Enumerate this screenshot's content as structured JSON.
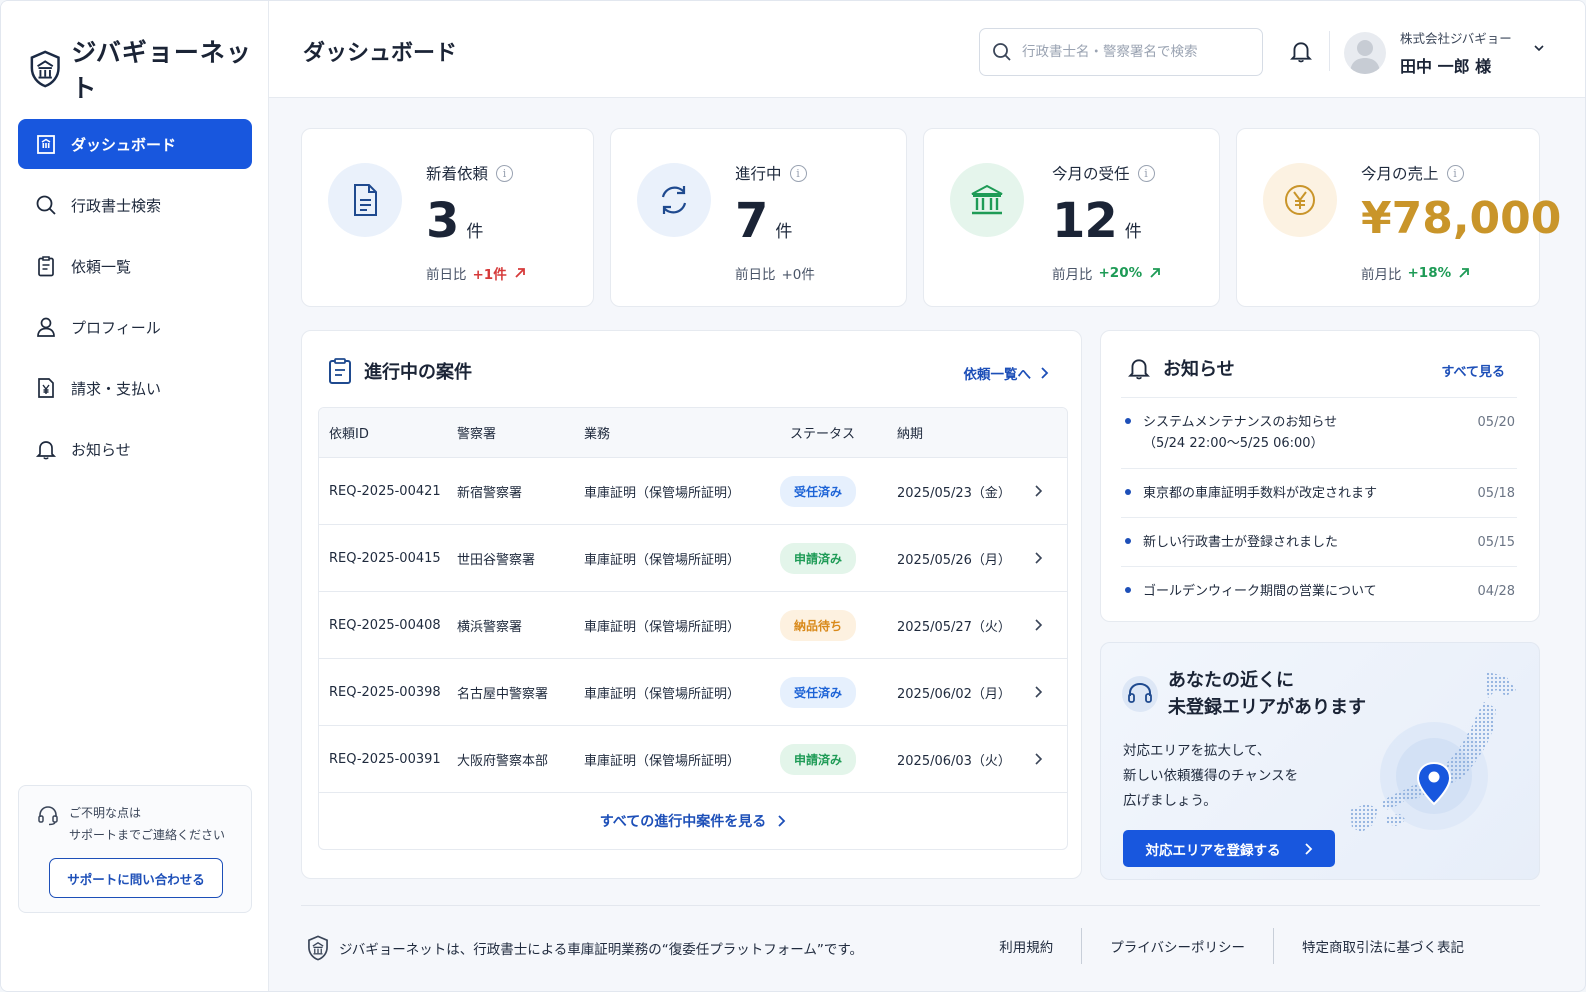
{
  "app": {
    "name": "ジバギョーネット"
  },
  "sidebar": {
    "items": [
      {
        "label": "ダッシュボード",
        "icon": "building-icon",
        "active": true
      },
      {
        "label": "行政書士検索",
        "icon": "search-icon"
      },
      {
        "label": "依頼一覧",
        "icon": "clipboard-icon"
      },
      {
        "label": "プロフィール",
        "icon": "user-icon"
      },
      {
        "label": "請求・支払い",
        "icon": "invoice-yen-icon"
      },
      {
        "label": "お知らせ",
        "icon": "bell-icon"
      }
    ],
    "support": {
      "line1": "ご不明な点は",
      "line2": "サポートまでご連絡ください",
      "button": "サポートに問い合わせる"
    }
  },
  "header": {
    "title": "ダッシュボード",
    "search_placeholder": "行政書士名・警察署名で検索",
    "user": {
      "company": "株式会社ジバギョー",
      "name": "田中 一郎 様"
    }
  },
  "stats": [
    {
      "label": "新着依頼",
      "value": "3",
      "unit": "件",
      "compare_label": "前日比",
      "delta": "+1件",
      "trend": "up",
      "color": "#d63a3a"
    },
    {
      "label": "進行中",
      "value": "7",
      "unit": "件",
      "compare_label": "前日比",
      "delta": "+0件",
      "trend": "flat"
    },
    {
      "label": "今月の受任",
      "value": "12",
      "unit": "件",
      "compare_label": "前月比",
      "delta": "+20%",
      "trend": "up",
      "color": "#1e9b56"
    },
    {
      "label": "今月の売上",
      "value": "¥78,000",
      "compare_label": "前月比",
      "delta": "+18%",
      "trend": "up",
      "color": "#1e9b56",
      "value_color": "#c9952a"
    }
  ],
  "cases": {
    "title": "進行中の案件",
    "link": "依頼一覧へ",
    "columns": [
      "依頼ID",
      "警察署",
      "業務",
      "ステータス",
      "納期"
    ],
    "rows": [
      {
        "id": "REQ-2025-00421",
        "station": "新宿警察署",
        "task": "車庫証明（保管場所証明）",
        "status": "受任済み",
        "status_color": "blue",
        "due": "2025/05/23（金）"
      },
      {
        "id": "REQ-2025-00415",
        "station": "世田谷警察署",
        "task": "車庫証明（保管場所証明）",
        "status": "申請済み",
        "status_color": "green",
        "due": "2025/05/26（月）"
      },
      {
        "id": "REQ-2025-00408",
        "station": "横浜警察署",
        "task": "車庫証明（保管場所証明）",
        "status": "納品待ち",
        "status_color": "orange",
        "due": "2025/05/27（火）"
      },
      {
        "id": "REQ-2025-00398",
        "station": "名古屋中警察署",
        "task": "車庫証明（保管場所証明）",
        "status": "受任済み",
        "status_color": "blue",
        "due": "2025/06/02（月）"
      },
      {
        "id": "REQ-2025-00391",
        "station": "大阪府警察本部",
        "task": "車庫証明（保管場所証明）",
        "status": "申請済み",
        "status_color": "green",
        "due": "2025/06/03（火）"
      }
    ],
    "footer_link": "すべての進行中案件を見る"
  },
  "notices": {
    "title": "お知らせ",
    "link": "すべて見る",
    "items": [
      {
        "text": "システムメンテナンスのお知らせ",
        "sub": "（5/24 22:00〜5/25 06:00）",
        "date": "05/20"
      },
      {
        "text": "東京都の車庫証明手数料が改定されます",
        "date": "05/18"
      },
      {
        "text": "新しい行政書士が登録されました",
        "date": "05/15"
      },
      {
        "text": "ゴールデンウィーク期間の営業について",
        "date": "04/28"
      }
    ]
  },
  "promo": {
    "title_line1": "あなたの近くに",
    "title_line2": "未登録エリアがあります",
    "body_line1": "対応エリアを拡大して、",
    "body_line2": "新しい依頼獲得のチャンスを",
    "body_line3": "広げましょう。",
    "button": "対応エリアを登録する"
  },
  "footer": {
    "text": "ジバギョーネットは、行政書士による車庫証明業務の“復委任プラットフォーム”です。",
    "links": [
      "利用規約",
      "プライバシーポリシー",
      "特定商取引法に基づく表記"
    ]
  },
  "colors": {
    "primary": "#1857de",
    "accent_gold": "#c9952a",
    "success": "#1e9b56",
    "danger": "#d63a3a"
  }
}
